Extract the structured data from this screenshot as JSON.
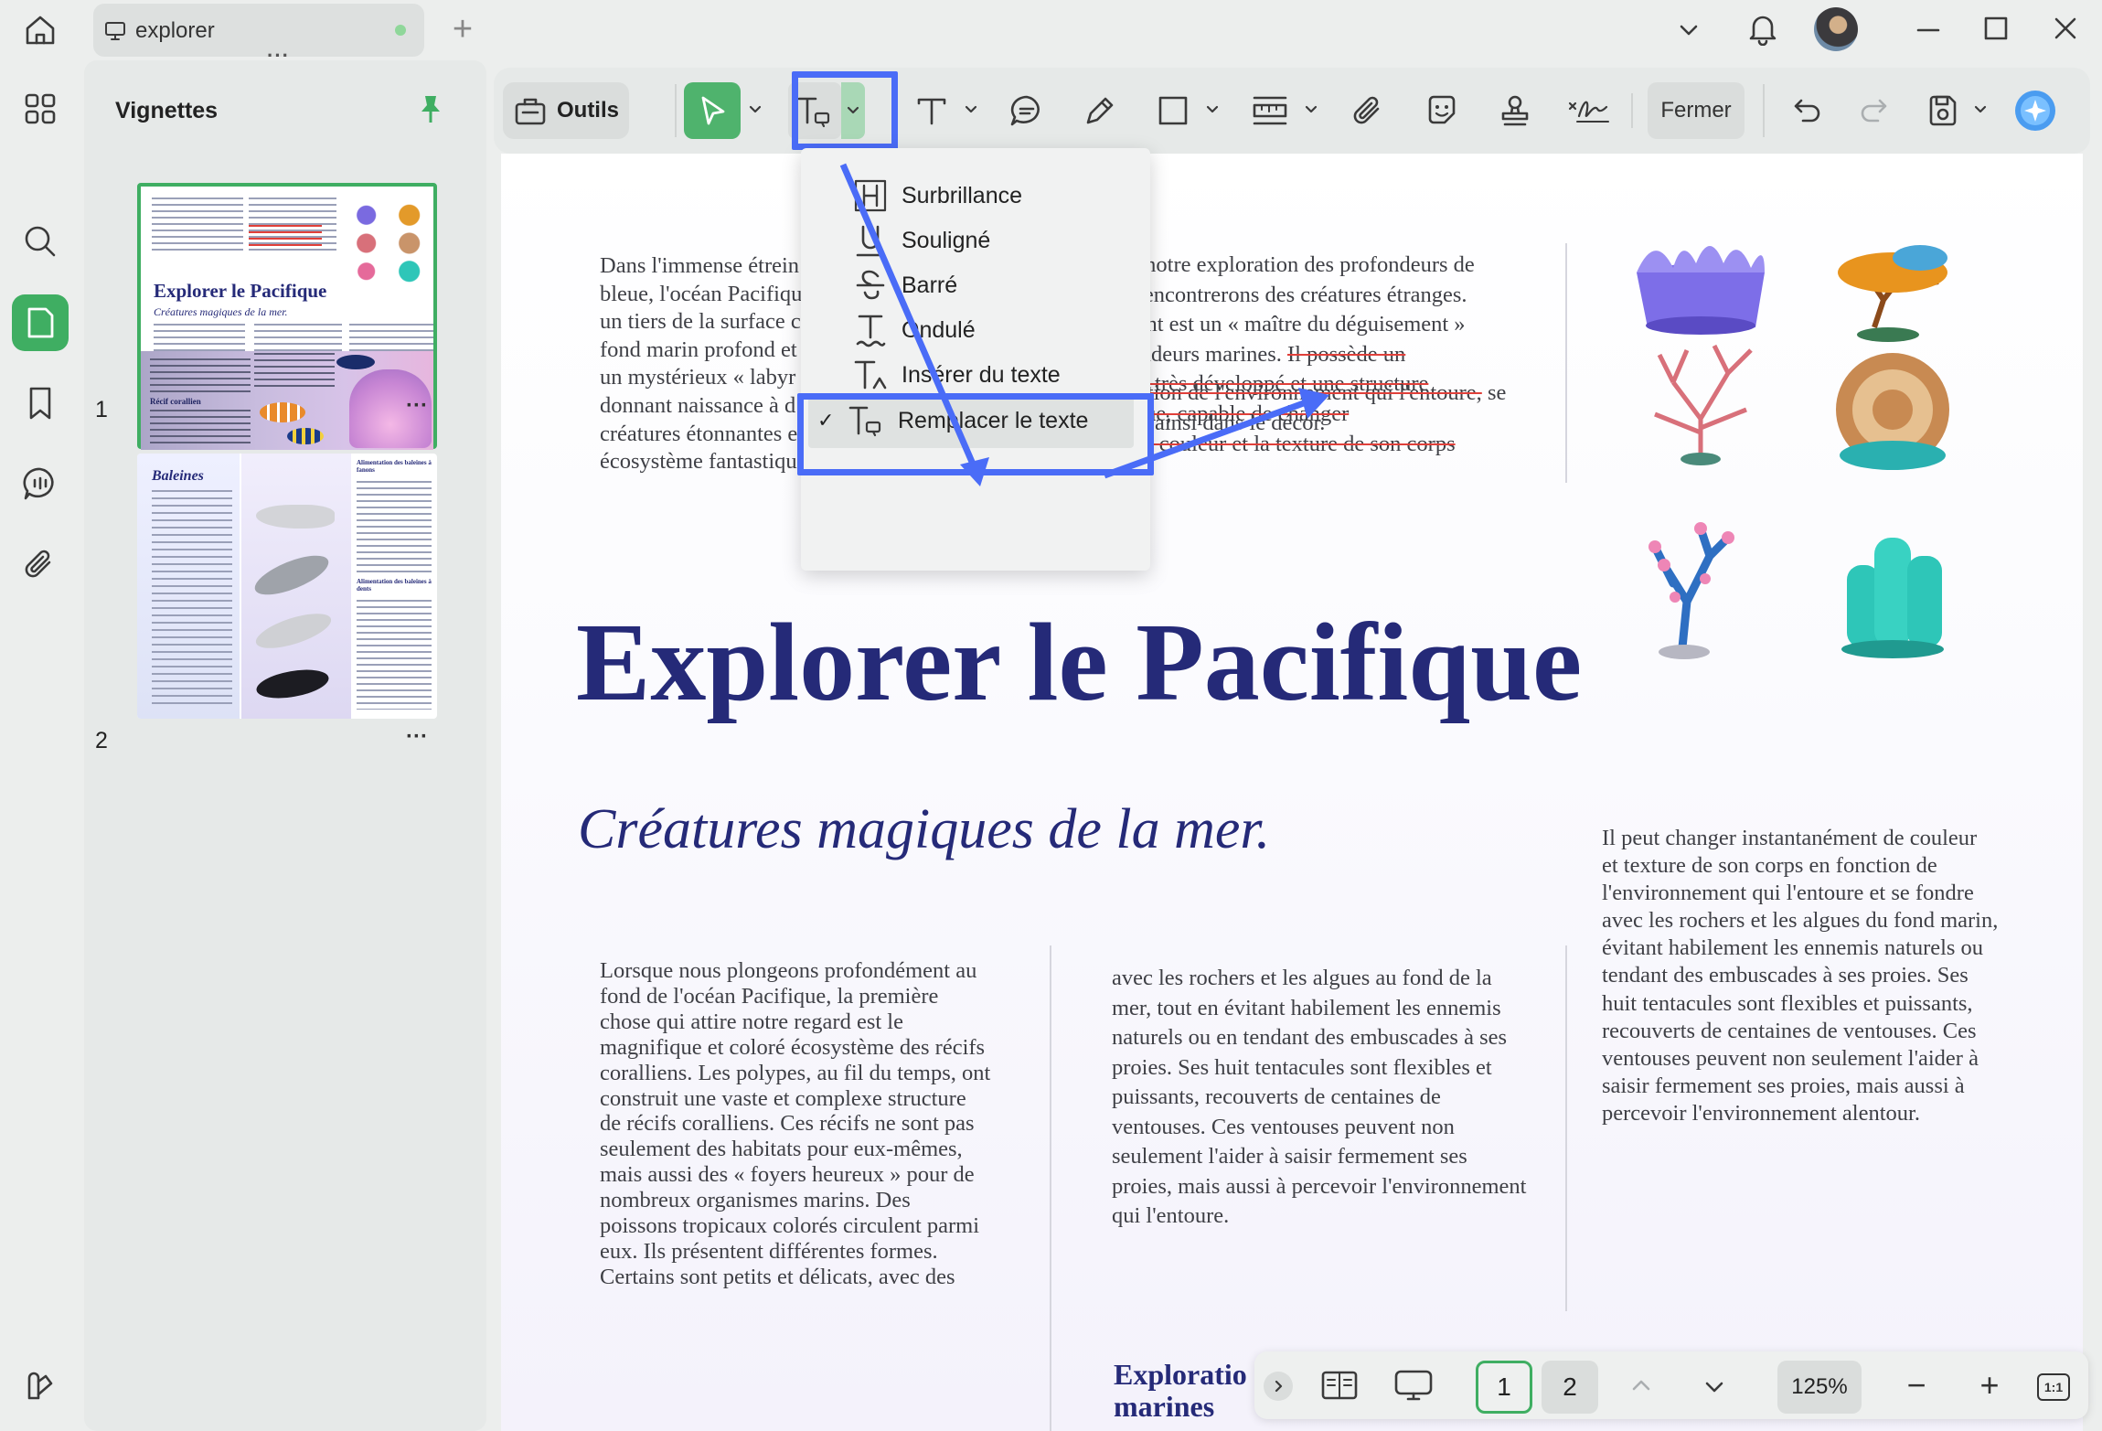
{
  "tab": {
    "title": "explorer",
    "add": "+"
  },
  "sidebar": {
    "title": "Vignettes",
    "pages": [
      {
        "num": "1",
        "more": "···"
      },
      {
        "num": "2",
        "more": "···"
      }
    ],
    "grip": "···"
  },
  "toolbar": {
    "tools_label": "Outils",
    "close_label": "Fermer"
  },
  "dropdown": {
    "items": [
      {
        "label": "Surbrillance",
        "icon": "highlight-icon"
      },
      {
        "label": "Souligné",
        "icon": "underline-icon"
      },
      {
        "label": "Barré",
        "icon": "strikethrough-icon"
      },
      {
        "label": "Ondulé",
        "icon": "squiggly-icon"
      },
      {
        "label": "Insérer du texte",
        "icon": "insert-text-icon"
      },
      {
        "label": "Remplacer le texte",
        "icon": "replace-text-icon",
        "checked": true
      }
    ],
    "check": "✓"
  },
  "thumb1": {
    "title": "Explorer le Pacifique",
    "subtitle": "Créatures magiques de la mer.",
    "recif": "Récif corallien",
    "exploration": "Exploration des profondeurs"
  },
  "thumb2": {
    "title": "Baleines",
    "h1": "Alimentation des baleines à fanons",
    "h2": "Alimentation des baleines à dents"
  },
  "document": {
    "title": "Explorer le Pacifique",
    "subtitle": "Créatures magiques de la mer.",
    "top_left": [
      "Dans l'immense étrein",
      "bleue, l'océan Pacifiqu",
      "un tiers de la surface c",
      "fond marin profond et",
      "un mystérieux « labyr",
      "donnant naissance à d",
      "créatures étonnantes e",
      "écosystème fantastiqu"
    ],
    "top_mid": [
      "tinuant notre exploration des profondeurs de",
      ", nous rencontrerons des créatures étranges.",
      "ope géant est un « maître du déguisement »",
      "s profondeurs marines."
    ],
    "struck": [
      "Il possède un",
      "nerveux très développé et une structure",
      "lle unique, capable de changer",
      "ément la couleur et la texture de son corps",
      "en fonction de l'environnement qui l'entoure,"
    ],
    "after_strike": " se",
    "top_mid_end": "fondant ainsi dans le décor.",
    "col1": [
      "Lorsque nous plongeons profondément au",
      "fond de l'océan Pacifique, la première",
      "chose qui attire notre regard est le",
      "magnifique et coloré écosystème des récifs",
      "coralliens. Les polypes, au fil du temps, ont",
      "construit une vaste et complexe structure",
      "de récifs coralliens. Ces récifs ne sont pas",
      "seulement des habitats pour eux-mêmes,",
      "mais aussi des « foyers heureux » pour de",
      "nombreux organismes marins. Des",
      "poissons tropicaux colorés circulent parmi",
      "eux. Ils présentent différentes formes.",
      "Certains sont petits et délicats, avec des"
    ],
    "col2": [
      "avec les rochers et les algues au fond de la",
      "mer, tout en évitant habilement les ennemis",
      "naturels ou en tendant des embuscades à ses",
      "proies. Ses huit tentacules sont flexibles et",
      "puissants, recouverts de centaines de",
      "ventouses. Ces ventouses peuvent non",
      "seulement l'aider à saisir fermement ses",
      "proies, mais aussi à percevoir l'environnement",
      "qui l'entoure."
    ],
    "col2_heading": [
      "Exploratio",
      "marines"
    ],
    "col3": [
      "Il peut changer instantanément de couleur",
      "et texture de son corps en fonction de",
      "l'environnement qui l'entoure et se fondre",
      "avec les rochers et les algues du fond marin,",
      "évitant habilement les ennemis naturels ou",
      "tendant des embuscades à ses proies. Ses",
      "huit tentacules sont flexibles et puissants,",
      "recouverts de centaines de ventouses. Ces",
      "ventouses peuvent non seulement l'aider à",
      "saisir fermement ses proies, mais aussi à",
      "percevoir l'environnement alentour."
    ]
  },
  "bottom": {
    "page1": "1",
    "page2": "2",
    "zoom": "125%",
    "fit": "1:1",
    "minus": "−",
    "plus": "+"
  },
  "colors": {
    "accent": "#4a6cf7",
    "doc_title": "#252a78",
    "select_green": "#4fb36d",
    "strike": "#e0403a"
  }
}
